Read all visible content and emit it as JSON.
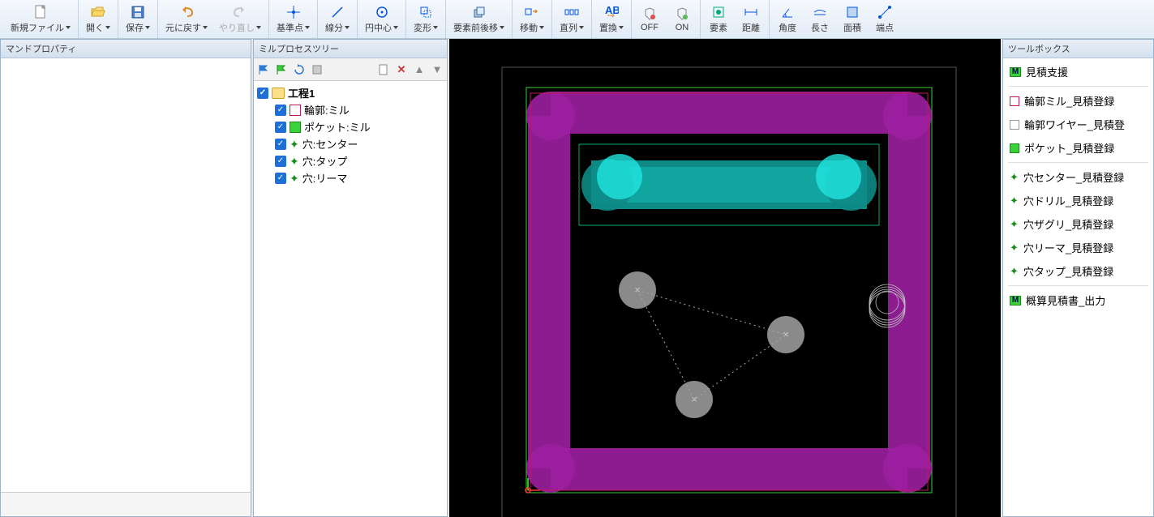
{
  "toolbar": {
    "new_file": "新規ファイル",
    "open": "開く",
    "save": "保存",
    "undo": "元に戻す",
    "redo": "やり直し",
    "base_point": "基準点",
    "line_seg": "線分",
    "circle_center": "円中心",
    "transform": "変形",
    "elem_order": "要素前後移",
    "move": "移動",
    "array": "直列",
    "replace": "置換",
    "off": "OFF",
    "on": "ON",
    "element": "要素",
    "distance": "距離",
    "angle": "角度",
    "length": "長さ",
    "area": "面積",
    "endpoint": "端点"
  },
  "panels": {
    "cmd_props": "マンドプロパティ",
    "mill_tree": "ミルプロセスツリー",
    "toolbox": "ツールボックス"
  },
  "tree": {
    "root": "工程1",
    "items": [
      {
        "type": "contour",
        "label": "輪郭:ミル"
      },
      {
        "type": "pocket",
        "label": "ポケット:ミル"
      },
      {
        "type": "drill",
        "label": "穴:センター"
      },
      {
        "type": "drill",
        "label": "穴:タップ"
      },
      {
        "type": "drill",
        "label": "穴:リーマ"
      }
    ]
  },
  "toolbox_items": {
    "header": "見積支援",
    "g1": [
      {
        "ico": "r",
        "label": "輪郭ミル_見積登録"
      },
      {
        "ico": "w",
        "label": "輪郭ワイヤー_見積登"
      },
      {
        "ico": "g",
        "label": "ポケット_見積登録"
      }
    ],
    "g2": [
      {
        "label": "穴センター_見積登録"
      },
      {
        "label": "穴ドリル_見積登録"
      },
      {
        "label": "穴ザグリ_見積登録"
      },
      {
        "label": "穴リーマ_見積登録"
      },
      {
        "label": "穴タップ_見積登録"
      }
    ],
    "out": "概算見積書_出力"
  }
}
